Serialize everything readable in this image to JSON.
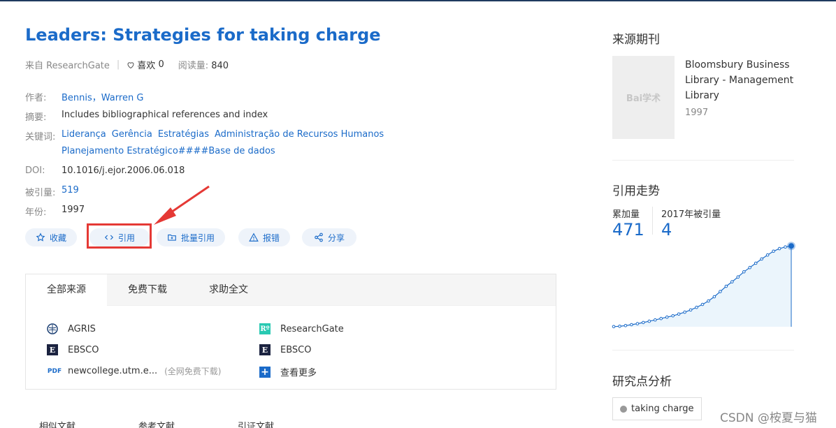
{
  "article": {
    "title": "Leaders: Strategies for taking charge",
    "source": "来自 ResearchGate",
    "likes_label": "喜欢",
    "likes": "0",
    "reads_label": "阅读量:",
    "reads": "840"
  },
  "fields": {
    "author_label": "作者:",
    "author": "Bennis，Warren G",
    "abstract_label": "摘要:",
    "abstract": "Includes bibliographical references and index",
    "keywords_label": "关键词:",
    "keywords": [
      "Liderança",
      "Gerência",
      "Estratégias",
      "Administração de Recursos Humanos"
    ],
    "keywords_line2": "Planejamento Estratégico####Base de dados",
    "doi_label": "DOI:",
    "doi": "10.1016/j.ejor.2006.06.018",
    "cited_label": "被引量:",
    "cited": "519",
    "year_label": "年份:",
    "year": "1997"
  },
  "actions": {
    "favorite": "收藏",
    "cite": "引用",
    "batch_cite": "批量引用",
    "report": "报错",
    "share": "分享"
  },
  "sources": {
    "tabs": [
      "全部来源",
      "免费下载",
      "求助全文"
    ],
    "left": [
      {
        "icon": "agris-icon",
        "name": "AGRIS"
      },
      {
        "icon": "ebsco-icon",
        "glyph": "E",
        "name": "EBSCO"
      },
      {
        "icon": "pdf-icon",
        "glyph": "PDF",
        "name": "newcollege.utm.e...",
        "note": "(全网免费下载)"
      }
    ],
    "right": [
      {
        "icon": "researchgate-icon",
        "glyph": "Rº",
        "name": "ResearchGate"
      },
      {
        "icon": "ebsco-icon",
        "glyph": "E",
        "name": "EBSCO"
      },
      {
        "icon": "plus-icon",
        "glyph": "+",
        "name": "查看更多"
      }
    ]
  },
  "lower_tabs": [
    "相似文献",
    "参考文献",
    "引证文献"
  ],
  "sidebar": {
    "journal_heading": "来源期刊",
    "cover_text": "Bai学术",
    "journal_title": "Bloomsbury Business Library - Management Library",
    "journal_year": "1997",
    "trend_heading": "引用走势",
    "total_label": "累加量",
    "total_value": "471",
    "year_cite_label": "2017年被引量",
    "year_cite_value": "4",
    "analysis_heading": "研究点分析",
    "keyword_tag": "taking charge"
  },
  "chart_data": {
    "type": "area",
    "title": "",
    "xlabel": "",
    "ylabel": "",
    "series": [
      {
        "values": [
          1,
          3,
          7,
          12,
          18,
          25,
          32,
          40,
          48,
          56,
          64,
          74,
          85,
          98,
          113,
          130,
          150,
          175,
          205,
          236,
          262,
          290,
          320,
          345,
          370,
          395,
          418,
          440,
          455,
          465,
          471
        ]
      }
    ],
    "ylim": [
      0,
      480
    ],
    "highlight_last": true,
    "grid": false,
    "accent": "#1b6bc9",
    "fill": "#ebf5fc"
  },
  "watermark": "CSDN @桉夏与猫"
}
